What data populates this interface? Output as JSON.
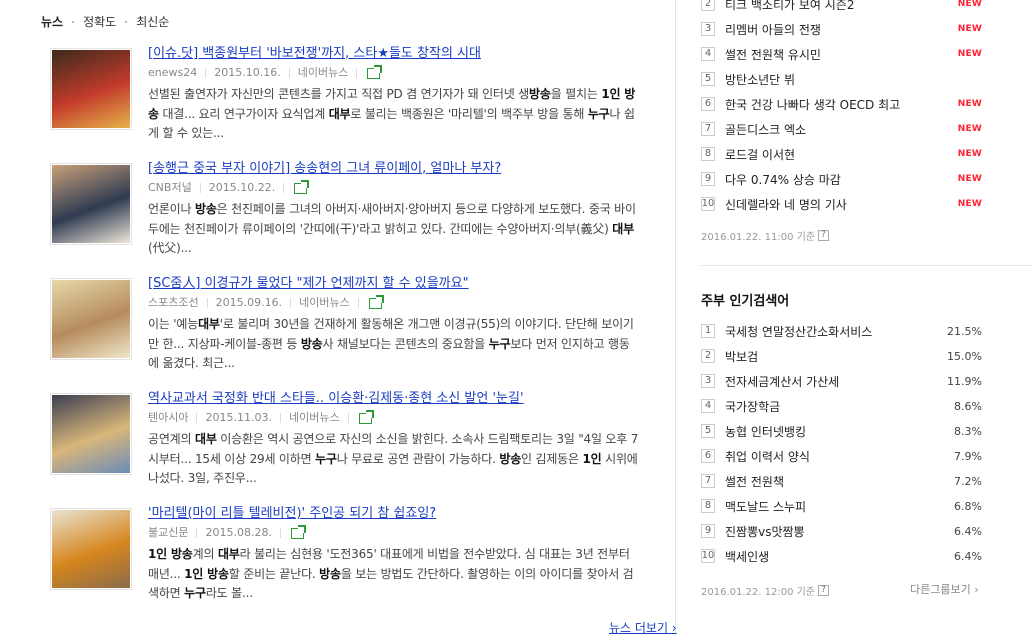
{
  "tabs": [
    "뉴스",
    "정확도",
    "최신순"
  ],
  "news": [
    {
      "title": "[이슈.닷] 백종원부터 '바보전쟁'까지, 스타★들도 창작의 시대",
      "source": "enews24",
      "date": "2015.10.16.",
      "portal": "네이버뉴스",
      "desc_html": "선별된 출연자가 자신만의 콘텐츠를 가지고 직접 PD 겸 연기자가 돼 인터넷 생<b>방송</b>을 펼치는 <b>1인 방송</b> 대결... 요리 연구가이자 요식업계 <b>대부</b>로 불리는 백종원은 '마리텔'의 백주부 방을 통해 <b>누구</b>나 쉽게 할 수 있는...",
      "thumb_colors": [
        "#3b2a1c",
        "#c23b2b",
        "#e6b24a"
      ]
    },
    {
      "title": "[송행근 중국 부자 이야기] 송송현의 그녀 류이페이, 얼마나 부자?",
      "source": "CNB저널",
      "date": "2015.10.22.",
      "portal": "",
      "desc_html": "언론이나 <b>방송</b>은 천진페이를 그녀의 아버지·새아버지·양아버지 등으로 다양하게 보도했다. 중국 바이두에는 천진페이가 류이페이의 '간띠에(干)'라고 밝히고 있다. 간띠에는 수양아버지·의부(義父) <b>대부</b>(代父)...",
      "thumb_colors": [
        "#c9a07a",
        "#2f3b52",
        "#efe6d8"
      ]
    },
    {
      "title": "[SC줌人] 이경규가 물었다 \"제가 언제까지 할 수 있을까요\"",
      "source": "스포츠조선",
      "date": "2015.09.16.",
      "portal": "네이버뉴스",
      "desc_html": "이는 '예능<b>대부</b>'로 불리며 30년을 건재하게 활동해온 개그맨 이경규(55)의 이야기다. 단단해 보이기만 한... 지상파-케이블-종편 등 <b>방송</b>사 채널보다는 콘텐츠의 중요함을 <b>누구</b>보다 먼저 인지하고 행동에 옮겼다. 최근...",
      "thumb_colors": [
        "#e6d9a8",
        "#b68b5e",
        "#f0e8c8"
      ]
    },
    {
      "title": "역사교과서 국정화 반대 스타들.. 이승환·김제동·종현 소신 발언 '눈길'",
      "source": "텐아시아",
      "date": "2015.11.03.",
      "portal": "네이버뉴스",
      "desc_html": "공연계의 <b>대부</b> 이승환은 역시 공연으로 자신의 소신을 밝힌다. 소속사 드림팩토리는 3일 \"4일 오후 7시부터... 15세 이상 29세 이하면 <b>누구</b>나 무료로 공연 관람이 가능하다. <b>방송</b>인 김제동은 <b>1인</b> 시위에 나섰다. 3일, 주진우...",
      "thumb_colors": [
        "#3b3f52",
        "#d9b67a",
        "#6b8cb8"
      ]
    },
    {
      "title": "'마리텔(마이 리틀 텔레비전)' 주인공 되기 참 쉽죠잉?",
      "source": "불교신문",
      "date": "2015.08.28.",
      "portal": "",
      "desc_html": "<b>1인 방송</b>계의 <b>대부</b>라 불리는 심현용 '도전365' 대표에게 비법을 전수받았다. 심 대표는 3년 전부터 매년... <b>1인 방송</b>할 준비는 끝난다. <b>방송</b>을 보는 방법도 간단하다. 촬영하는 이의 아이디를 찾아서 검색하면 <b>누구</b>라도 볼...",
      "thumb_colors": [
        "#e9e3d3",
        "#d6861e",
        "#8a6b4a"
      ]
    }
  ],
  "more_label": "뉴스 더보기",
  "realtime": [
    {
      "num": "2",
      "text": "티크 백소티가 보여 시즌2",
      "new": "NEW"
    },
    {
      "num": "3",
      "text": "리멤버 아들의 전쟁",
      "new": "NEW"
    },
    {
      "num": "4",
      "text": "썰전 전원책 유시민",
      "new": "NEW"
    },
    {
      "num": "5",
      "text": "방탄소년단 뷔",
      "new": ""
    },
    {
      "num": "6",
      "text": "한국 건강 나빠다 생각 OECD 최고",
      "new": "NEW"
    },
    {
      "num": "7",
      "text": "골든디스크 엑소",
      "new": "NEW"
    },
    {
      "num": "8",
      "text": "로드걸 이서현",
      "new": "NEW"
    },
    {
      "num": "9",
      "text": "다우 0.74% 상승 마감",
      "new": "NEW"
    },
    {
      "num": "10",
      "text": "신데렐라와 네 명의 기사",
      "new": "NEW"
    }
  ],
  "realtime_stamp": "2016.01.22. 11:00 기준",
  "weekly_title": "주부 인기검색어",
  "weekly": [
    {
      "num": "1",
      "text": "국세청 연말정산간소화서비스",
      "pct": "21.5%"
    },
    {
      "num": "2",
      "text": "박보검",
      "pct": "15.0%"
    },
    {
      "num": "3",
      "text": "전자세금계산서 가산세",
      "pct": "11.9%"
    },
    {
      "num": "4",
      "text": "국가장학금",
      "pct": "8.6%"
    },
    {
      "num": "5",
      "text": "농협 인터넷뱅킹",
      "pct": "8.3%"
    },
    {
      "num": "6",
      "text": "취업 이력서 양식",
      "pct": "7.9%"
    },
    {
      "num": "7",
      "text": "썰전 전원책",
      "pct": "7.2%"
    },
    {
      "num": "8",
      "text": "맥도날드 스누피",
      "pct": "6.8%"
    },
    {
      "num": "9",
      "text": "진짬뽕vs맛짬뽕",
      "pct": "6.4%"
    },
    {
      "num": "10",
      "text": "백세인생",
      "pct": "6.4%"
    }
  ],
  "weekly_stamp": "2016.01.22. 12:00 기준",
  "other_group": "다른그룹보기",
  "qmark": "?"
}
